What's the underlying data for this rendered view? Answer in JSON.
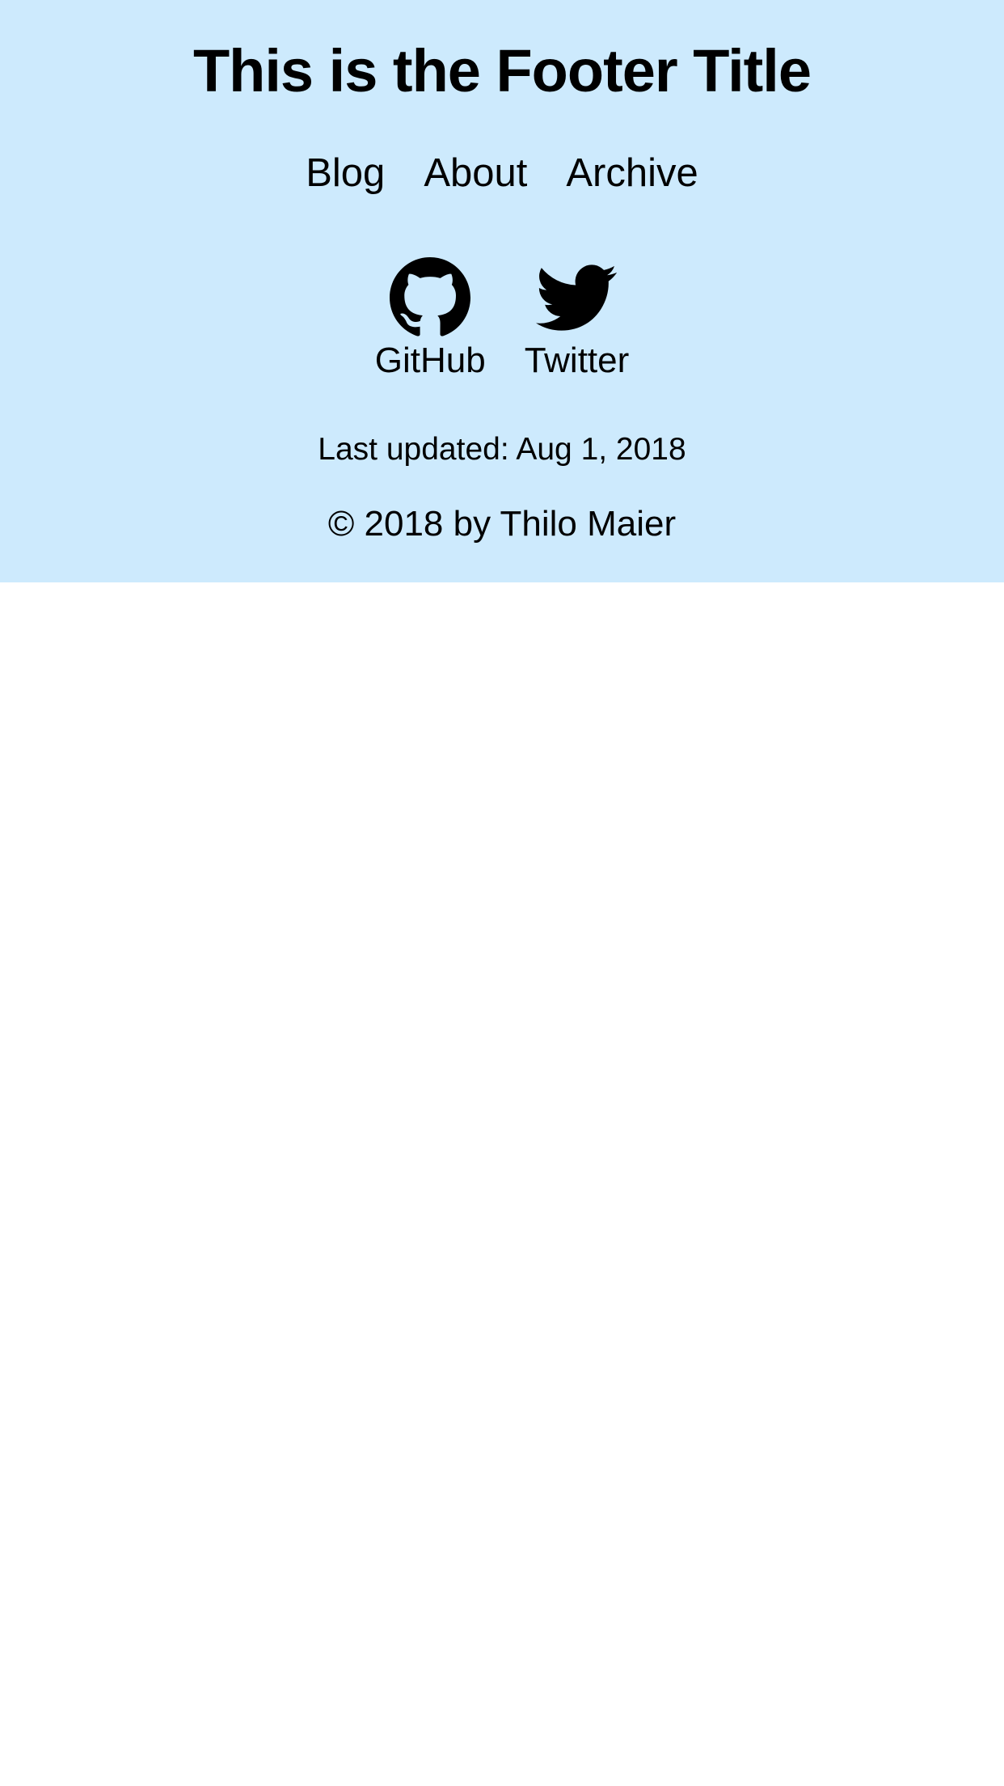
{
  "footer": {
    "title": "This is the Footer Title",
    "background_color": "#cdeafd",
    "nav": [
      {
        "label": "Blog"
      },
      {
        "label": "About"
      },
      {
        "label": "Archive"
      }
    ],
    "social": [
      {
        "label": "GitHub",
        "icon": "github-icon"
      },
      {
        "label": "Twitter",
        "icon": "twitter-icon"
      }
    ],
    "last_updated": "Last updated: Aug 1, 2018",
    "copyright": "© 2018 by Thilo Maier"
  }
}
